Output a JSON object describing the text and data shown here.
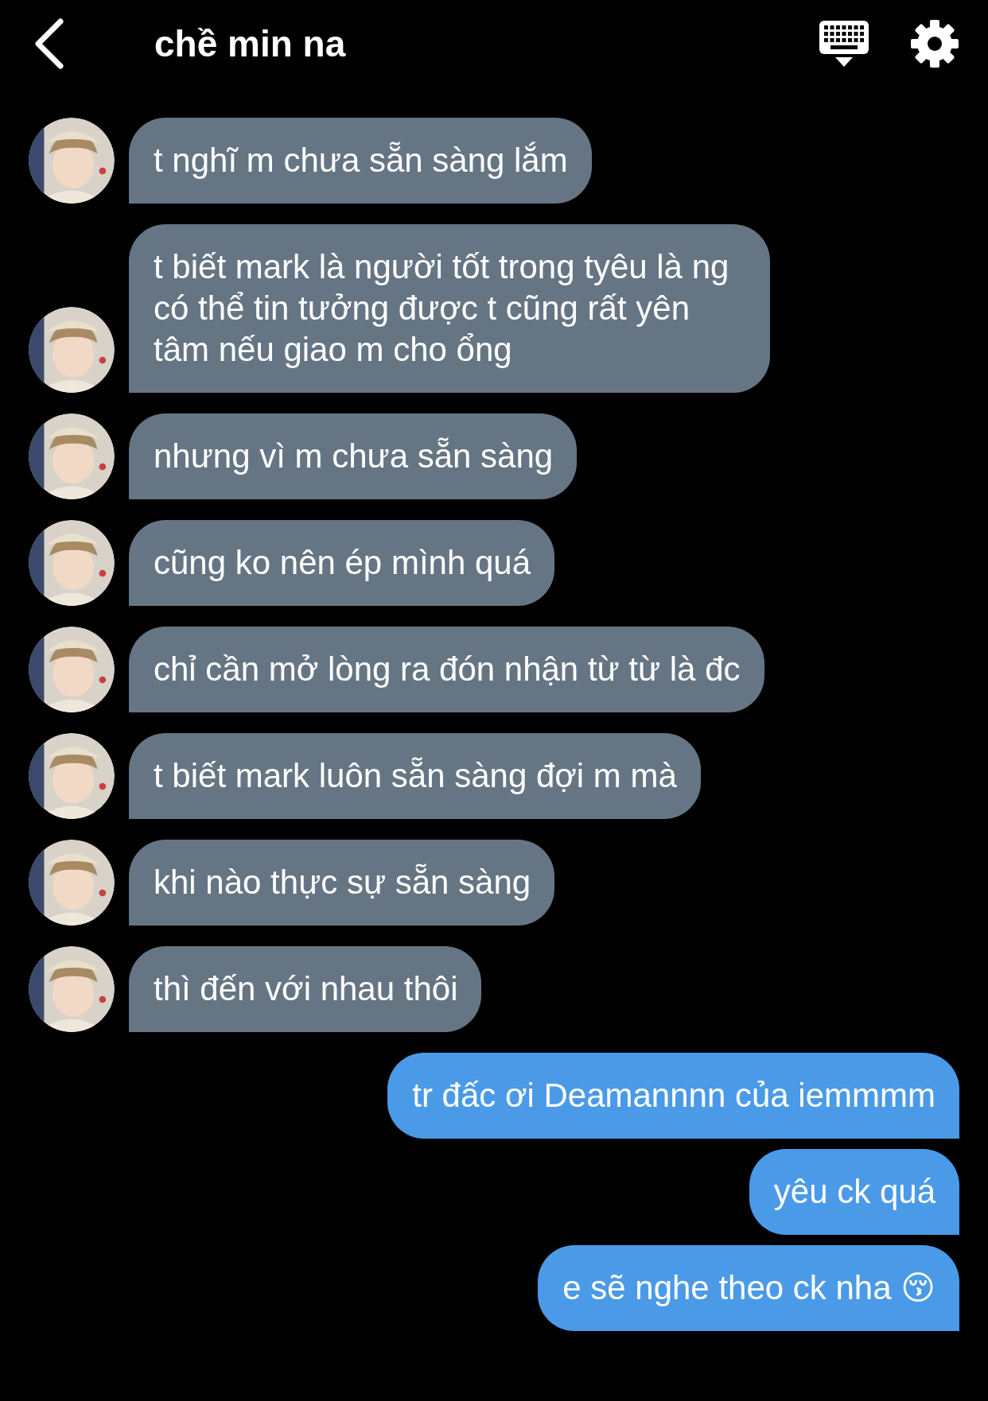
{
  "header": {
    "title": "chề min na"
  },
  "messages": [
    {
      "kind": "incoming",
      "text": "t nghĩ m chưa sẵn sàng lắm"
    },
    {
      "kind": "incoming",
      "text": "t biết mark là người tốt trong tyêu là ng có thể tin tưởng được t cũng rất yên tâm nếu giao m cho ổng"
    },
    {
      "kind": "incoming",
      "text": "nhưng vì m chưa sẵn sàng"
    },
    {
      "kind": "incoming",
      "text": "cũng ko nên ép mình quá"
    },
    {
      "kind": "incoming",
      "text": "chỉ cần mở lòng ra đón nhận từ từ là đc"
    },
    {
      "kind": "incoming",
      "text": "t biết mark luôn sẵn sàng đợi m mà"
    },
    {
      "kind": "incoming",
      "text": "khi nào thực sự sẵn sàng"
    },
    {
      "kind": "incoming",
      "text": "thì đến với nhau thôi"
    },
    {
      "kind": "outgoing",
      "text": "tr đấc ơi Deamannnn của iemmmm"
    },
    {
      "kind": "outgoing",
      "text": "yêu ck quá"
    },
    {
      "kind": "outgoing",
      "text": "e sẽ nghe theo ck nha 😚"
    }
  ]
}
